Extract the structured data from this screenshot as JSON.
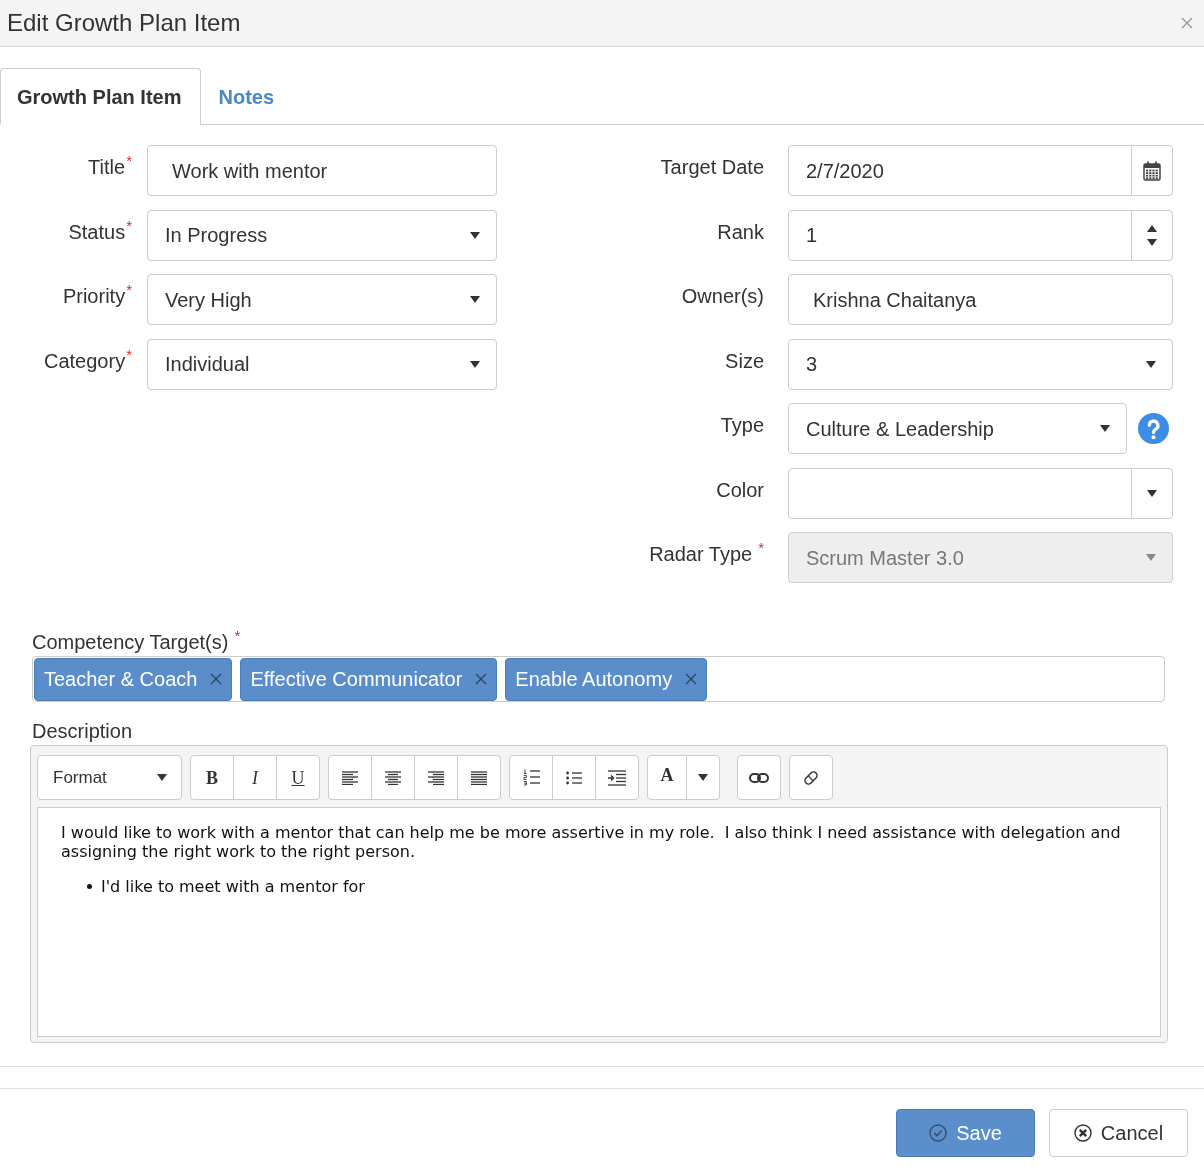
{
  "dialog": {
    "title": "Edit Growth Plan Item"
  },
  "tabs": [
    {
      "label": "Growth Plan Item",
      "selected": true
    },
    {
      "label": "Notes",
      "selected": false
    }
  ],
  "left_fields": [
    {
      "label": "Title",
      "required_mark": "*",
      "kind": "text",
      "value": "Work with mentor",
      "disabled": false
    },
    {
      "label": "Status",
      "required_mark": "*",
      "kind": "select",
      "value": "In Progress",
      "disabled": false
    },
    {
      "label": "Priority",
      "required_mark": "*",
      "kind": "select",
      "value": "Very High",
      "disabled": false
    },
    {
      "label": "Category",
      "required_mark": "*",
      "kind": "select",
      "value": "Individual",
      "disabled": false
    }
  ],
  "right_fields": [
    {
      "label": "Target Date",
      "kind": "date",
      "value": "2/7/2020",
      "disabled": false
    },
    {
      "label": "Rank",
      "kind": "number",
      "value": "1",
      "disabled": false
    },
    {
      "label": "Owner(s)",
      "kind": "text",
      "value": "Krishna Chaitanya",
      "disabled": false
    },
    {
      "label": "Size",
      "kind": "select",
      "value": "3",
      "disabled": false
    },
    {
      "label": "Type",
      "kind": "select",
      "value": "Culture & Leadership",
      "help": true,
      "disabled": false
    },
    {
      "label": "Color",
      "kind": "color",
      "disabled": false
    },
    {
      "label": "Radar Type",
      "required_mark": "*",
      "kind": "select",
      "value": "Scrum Master 3.0",
      "disabled": true
    }
  ],
  "competency": {
    "label": "Competency Target(s)",
    "required_mark": "*",
    "tags": [
      "Teacher & Coach",
      "Effective Communicator",
      "Enable Autonomy"
    ]
  },
  "description": {
    "label": "Description",
    "toolbar_groups": [
      {
        "buttons": [
          {
            "kind": "format",
            "label": "Format"
          }
        ]
      },
      {
        "buttons": [
          {
            "kind": "bold",
            "label": "B"
          },
          {
            "kind": "italic",
            "label": "I"
          },
          {
            "kind": "underline",
            "label": "U"
          }
        ]
      },
      {
        "buttons": [
          {
            "kind": "align-left"
          },
          {
            "kind": "align-center"
          },
          {
            "kind": "align-right"
          },
          {
            "kind": "justify"
          }
        ]
      },
      {
        "buttons": [
          {
            "kind": "ordered-list"
          },
          {
            "kind": "bullet-list"
          },
          {
            "kind": "indent"
          }
        ]
      },
      {
        "buttons": [
          {
            "kind": "font-color",
            "label": "A"
          },
          {
            "kind": "dropdown"
          }
        ]
      },
      {
        "buttons": [
          {
            "kind": "link"
          }
        ]
      },
      {
        "buttons": [
          {
            "kind": "eraser"
          }
        ]
      }
    ],
    "content": [
      {
        "kind": "paragraph",
        "text": "I would like to work with a mentor that can help me be more assertive in my role.  I also think I need assistance with delegation and assigning the right work to the right person."
      },
      {
        "kind": "bullets",
        "items": [
          "I'd like to meet with a mentor for"
        ]
      }
    ]
  },
  "footer_buttons": [
    {
      "kind": "primary",
      "label": "Save"
    },
    {
      "kind": "secondary",
      "label": "Cancel"
    }
  ]
}
